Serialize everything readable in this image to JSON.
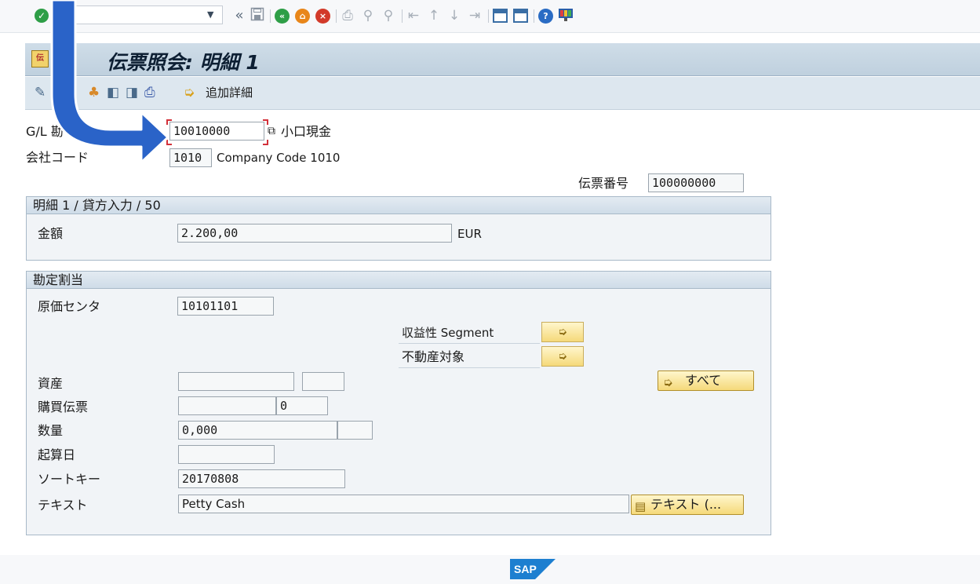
{
  "toolbar": {
    "icons": [
      "enter-check-icon",
      "command-dropdown-icon",
      "collapse-icon",
      "save-icon",
      "back-icon",
      "exit-icon",
      "cancel-icon",
      "print-icon",
      "find-icon",
      "find-next-icon",
      "first-page-icon",
      "previous-page-icon",
      "next-page-icon",
      "last-page-icon",
      "create-session-icon",
      "shortcut-icon",
      "help-icon",
      "customize-layout-icon"
    ],
    "collapse_glyph": "«",
    "colors": {
      "green": "#2e9e47",
      "orange": "#e8861a",
      "red": "#d23a2a",
      "help_blue": "#2a6cc4"
    }
  },
  "header": {
    "title": "伝票照会: 明細 1"
  },
  "app_toolbar": {
    "more_details_label": "追加詳細"
  },
  "account": {
    "gl_label": "G/L 勘",
    "gl_value": "10010000",
    "gl_description": "小口現金",
    "company_label": "会社コード",
    "company_value": "1010",
    "company_name": "Company Code 1010",
    "doc_no_label": "伝票番号",
    "doc_no_value": "100000000"
  },
  "item_group": {
    "header": "明細 1 / 貸方入力 / 50",
    "amount_label": "金額",
    "amount_value": "2.200,00",
    "currency": "EUR"
  },
  "assignment_group": {
    "header": "勘定割当",
    "cost_center_label": "原価センタ",
    "cost_center_value": "10101101",
    "profitability_label": "収益性 Segment",
    "real_estate_label": "不動産対象",
    "asset_label": "資産",
    "asset_value": "",
    "asset_sub_value": "",
    "po_label": "購買伝票",
    "po_value": "",
    "po_item_value": "0",
    "quantity_label": "数量",
    "quantity_value": "0,000",
    "quantity_unit": "",
    "value_date_label": "起算日",
    "value_date_value": "",
    "sort_key_label": "ソートキー",
    "sort_key_value": "20170808",
    "text_label": "テキスト",
    "text_value": "Petty Cash",
    "all_button": "すべて",
    "text_button": "テキスト (..."
  },
  "footer": {
    "logo_text": "SAP"
  },
  "annotation": {
    "arrow_color": "#2a63c8"
  }
}
